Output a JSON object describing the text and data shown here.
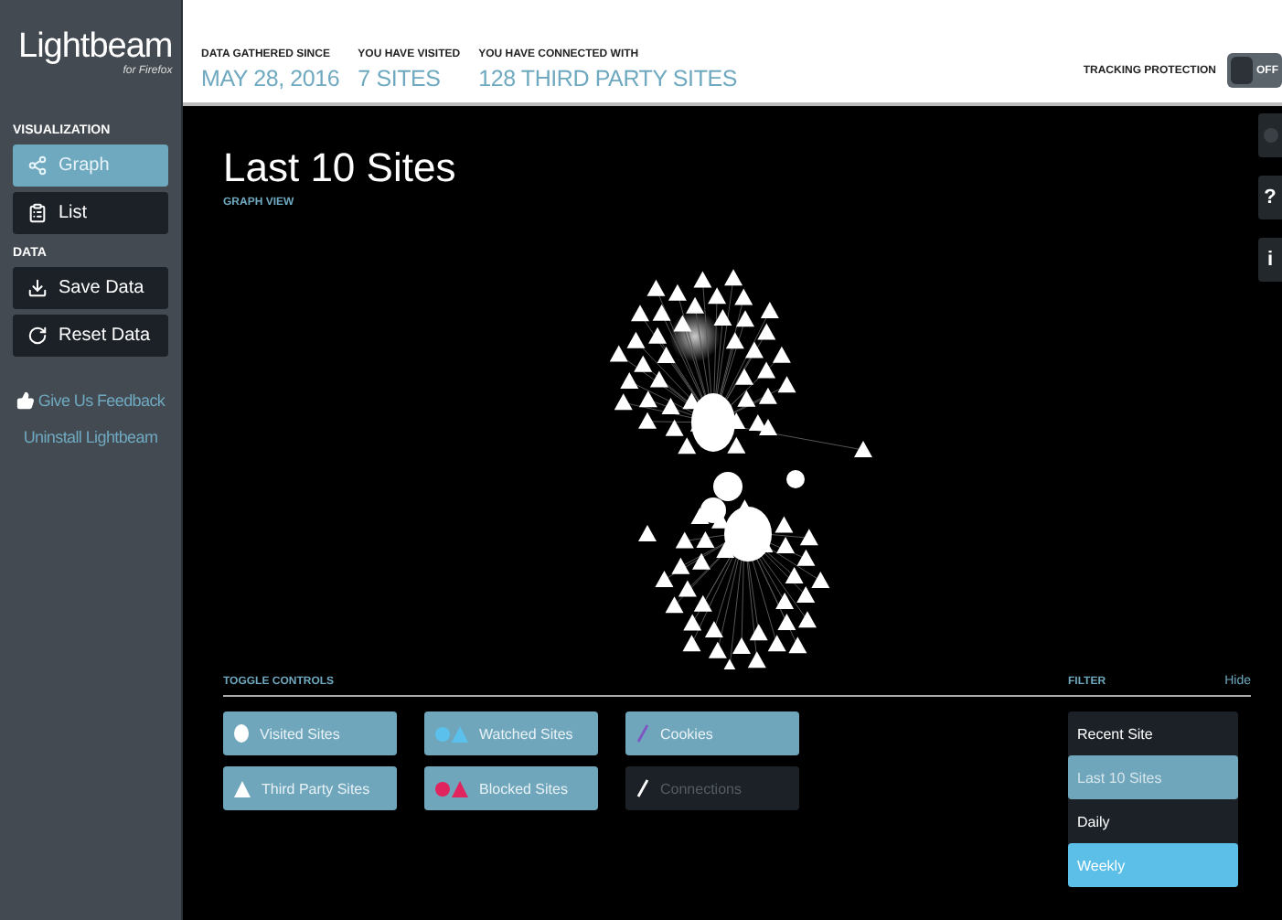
{
  "sidebar": {
    "logo": {
      "name": "Lightbeam",
      "tagline": "for Firefox"
    },
    "sections": [
      {
        "heading": "VISUALIZATION",
        "items": [
          {
            "label": "Graph",
            "kind": "graph",
            "selected": true
          },
          {
            "label": "List",
            "kind": "list",
            "selected": false
          }
        ]
      },
      {
        "heading": "DATA",
        "items": [
          {
            "label": "Save Data",
            "kind": "save",
            "selected": false
          },
          {
            "label": "Reset Data",
            "kind": "reset",
            "selected": false
          }
        ]
      }
    ],
    "links": [
      {
        "label": "Give Us Feedback"
      },
      {
        "label": "Uninstall Lightbeam"
      }
    ]
  },
  "stats": [
    {
      "label": "DATA GATHERED SINCE",
      "value": "MAY 28, 2016"
    },
    {
      "label": "YOU HAVE VISITED",
      "value": "7 SITES"
    },
    {
      "label": "YOU HAVE CONNECTED WITH",
      "value": "128 THIRD PARTY SITES"
    }
  ],
  "tracking_protection": {
    "label": "TRACKING PROTECTION",
    "on": false,
    "state_text": "OFF"
  },
  "view": {
    "title": "Last 10 Sites",
    "subtitle": "GRAPH VIEW"
  },
  "side_buttons": [
    {
      "kind": "dot"
    },
    {
      "kind": "glyph",
      "text": "?"
    },
    {
      "kind": "glyph",
      "text": "i"
    }
  ],
  "toggle_controls": {
    "heading": "TOGGLE CONTROLS",
    "items": [
      {
        "label": "Visited Sites",
        "kind": "circle",
        "color": "#ffffff",
        "on": true
      },
      {
        "label": "Watched Sites",
        "kind": "pair",
        "color": "#5bc0eb",
        "on": true
      },
      {
        "label": "Cookies",
        "kind": "line",
        "color": "#7e57c2",
        "on": true
      },
      {
        "label": "Third Party Sites",
        "kind": "triangle",
        "color": "#ffffff",
        "on": true
      },
      {
        "label": "Blocked Sites",
        "kind": "pair",
        "color": "#e0245e",
        "on": true
      },
      {
        "label": "Connections",
        "kind": "line",
        "color": "#ffffff",
        "on": false
      }
    ]
  },
  "filter": {
    "heading": "FILTER",
    "hide": "Hide",
    "items": [
      {
        "label": "Recent Site",
        "selected": false,
        "hovered": false
      },
      {
        "label": "Last 10 Sites",
        "selected": true,
        "hovered": false
      },
      {
        "label": "Daily",
        "selected": false,
        "hovered": false
      },
      {
        "label": "Weekly",
        "selected": false,
        "hovered": true
      }
    ]
  }
}
